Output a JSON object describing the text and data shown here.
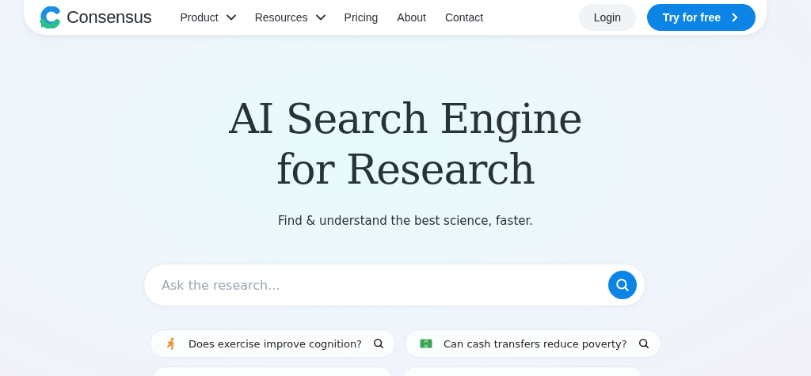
{
  "nav": {
    "brand": "Consensus",
    "links": [
      {
        "label": "Product",
        "kind": "dropdown"
      },
      {
        "label": "Resources",
        "kind": "dropdown"
      },
      {
        "label": "Pricing",
        "kind": "link"
      },
      {
        "label": "About",
        "kind": "link"
      },
      {
        "label": "Contact",
        "kind": "link"
      }
    ],
    "login": "Login",
    "cta": "Try for free"
  },
  "hero": {
    "title_lines": [
      "AI Search Engine",
      "for Research"
    ],
    "subtitle": "Find & understand the best science, faster."
  },
  "search": {
    "placeholder": "Ask the research..."
  },
  "suggestions": [
    {
      "kind": "runner",
      "text": "Does exercise improve cognition?"
    },
    {
      "kind": "money",
      "text": "Can cash transfers reduce poverty?"
    }
  ]
}
